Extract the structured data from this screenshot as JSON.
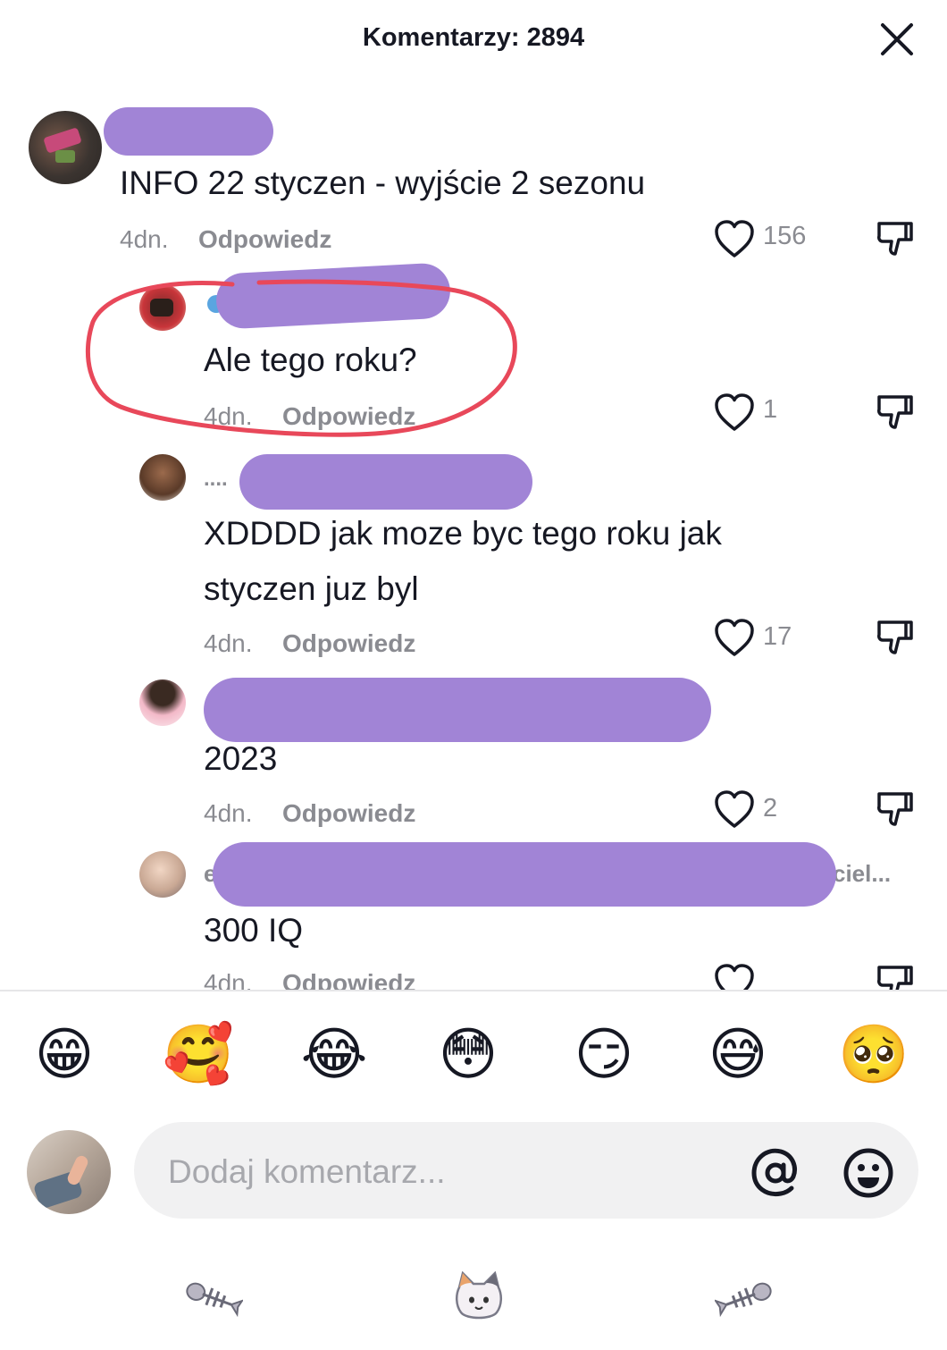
{
  "header": {
    "title": "Komentarzy: 2894"
  },
  "comments": [
    {
      "text": "INFO 22 styczen - wyjście 2 sezonu",
      "time": "4dn.",
      "reply": "Odpowiedz",
      "likes": "156"
    },
    {
      "text": "Ale tego roku?",
      "time": "4dn.",
      "reply": "Odpowiedz",
      "likes": "1"
    },
    {
      "prefix": "....",
      "text_line1": "XDDDD jak moze byc tego roku jak",
      "text_line2": "styczen juz byl",
      "time": "4dn.",
      "reply": "Odpowiedz",
      "likes": "17"
    },
    {
      "text": "2023",
      "time": "4dn.",
      "reply": "Odpowiedz",
      "likes": "2"
    },
    {
      "prefix": "e",
      "suffix": "ciel...",
      "text": "300 IQ",
      "time": "4dn.",
      "reply": "Odpowiedz"
    }
  ],
  "emoji_bar": [
    "😁",
    "🥰",
    "😂",
    "😳",
    "😏",
    "😅",
    "🥺"
  ],
  "input": {
    "placeholder": "Dodaj komentarz..."
  },
  "icons": {
    "close": "close-icon",
    "like": "heart-outline-icon",
    "dislike": "thumbs-down-icon",
    "mention": "at-sign-icon",
    "emoji_picker": "smiley-icon",
    "nav": [
      "fish-bone-left-icon",
      "cat-face-icon",
      "fish-bone-right-icon"
    ]
  },
  "colors": {
    "redaction": "#a184d6",
    "highlight_circle": "#e8485a",
    "muted_text": "#8a8b91"
  }
}
